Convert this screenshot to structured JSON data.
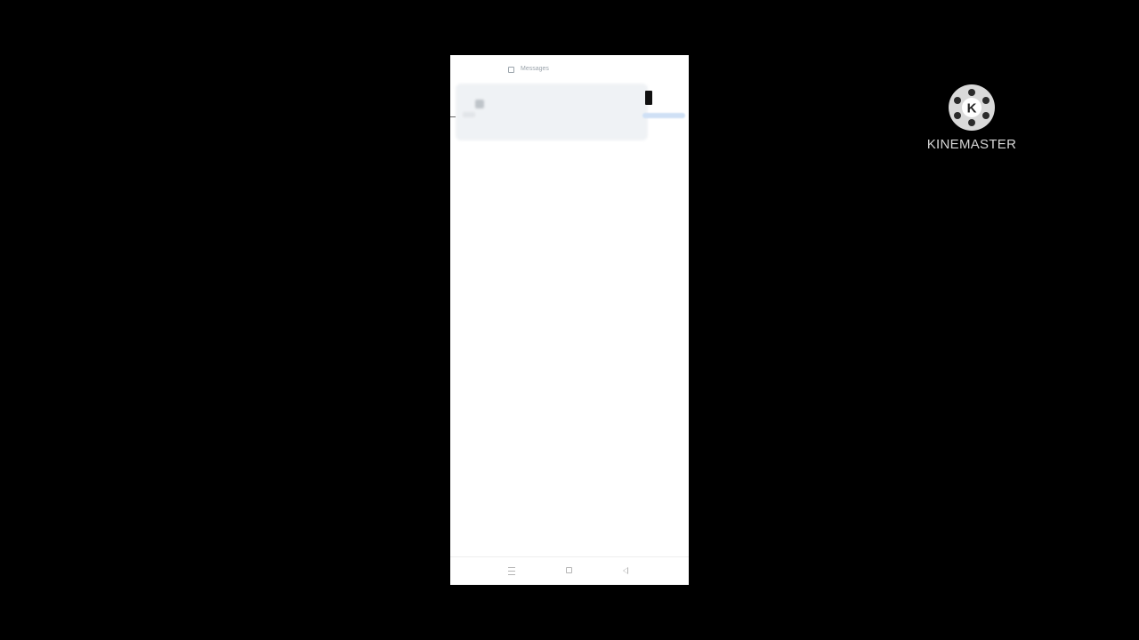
{
  "screen": {
    "status_bar": {
      "app_name": "Messages",
      "icon": "app-square-icon"
    },
    "notification": {
      "app_icon": "notification-app-icon",
      "action_icon": "notification-action-icon"
    },
    "navigation": {
      "buttons": [
        {
          "name": "menu",
          "icon": "menu-icon"
        },
        {
          "name": "home",
          "icon": "home-icon"
        },
        {
          "name": "back",
          "icon": "back-icon"
        }
      ]
    }
  },
  "watermark": {
    "brand": "KINEMASTER",
    "logo_letter": "K",
    "icon": "kinemaster-logo"
  },
  "colors": {
    "background": "#000000",
    "screen": "#ffffff",
    "notification_bg": "#eef1f4",
    "progress": "#cfe0f5",
    "watermark": "#d6d6d6"
  }
}
